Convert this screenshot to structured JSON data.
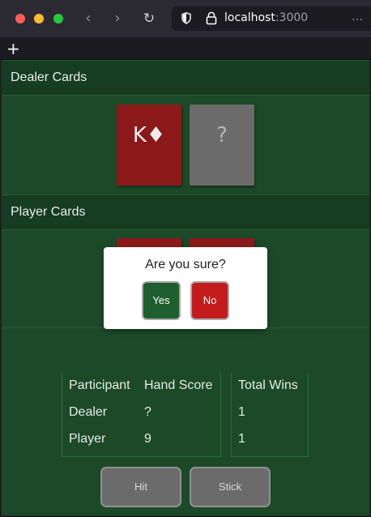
{
  "browser": {
    "url_host": "localhost",
    "url_port": ":3000",
    "new_tab_label": "+",
    "back_icon": "chevron-left-icon",
    "forward_icon": "chevron-right-icon",
    "reload_icon": "reload-icon"
  },
  "dealer": {
    "heading": "Dealer Cards",
    "cards": [
      {
        "label": "K♦",
        "face": "red"
      },
      {
        "label": "?",
        "face": "hidden"
      }
    ]
  },
  "player": {
    "heading": "Player Cards"
  },
  "scoreboard": {
    "headers": [
      "Participant",
      "Hand Score",
      "Total Wins"
    ],
    "rows": [
      {
        "participant": "Dealer",
        "score": "?",
        "wins": "1"
      },
      {
        "participant": "Player",
        "score": "9",
        "wins": "1"
      }
    ]
  },
  "actions": {
    "hit_label": "Hit",
    "stick_label": "Stick"
  },
  "dialog": {
    "title": "Are you sure?",
    "yes_label": "Yes",
    "no_label": "No"
  },
  "colors": {
    "table_green": "#1c4a29",
    "card_red": "#8c1919",
    "card_hidden": "#6b6b6b",
    "yes_green": "#1f5e2f",
    "no_red": "#c41c1c"
  }
}
